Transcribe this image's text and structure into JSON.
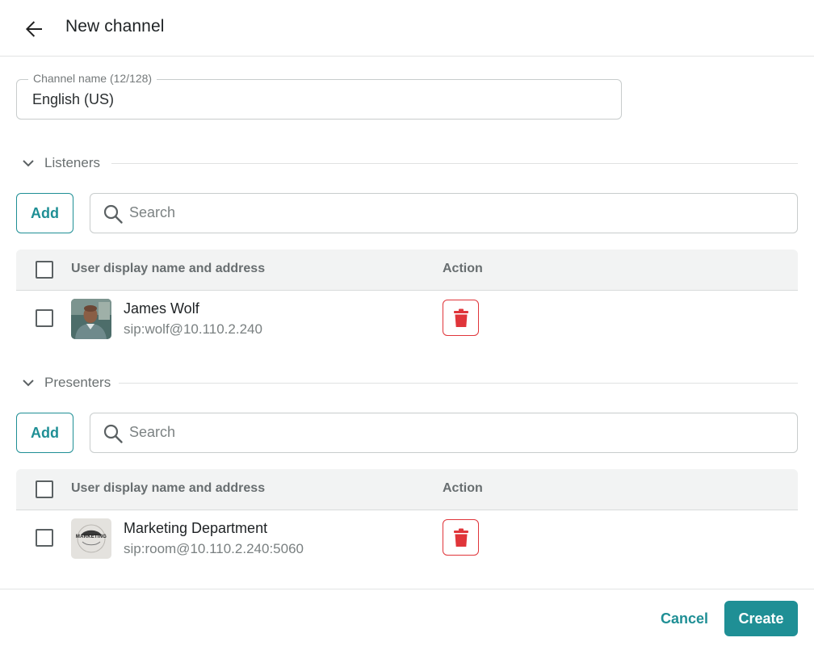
{
  "header": {
    "title": "New channel"
  },
  "channel_name": {
    "label": "Channel name (12/128)",
    "value": "English (US)"
  },
  "listeners": {
    "section_label": "Listeners",
    "add_label": "Add",
    "search_placeholder": "Search",
    "columns": {
      "user": "User display name and address",
      "action": "Action"
    },
    "rows": [
      {
        "name": "James Wolf",
        "address": "sip:wolf@10.110.2.240",
        "avatar": "person-photo"
      }
    ]
  },
  "presenters": {
    "section_label": "Presenters",
    "add_label": "Add",
    "search_placeholder": "Search",
    "columns": {
      "user": "User display name and address",
      "action": "Action"
    },
    "rows": [
      {
        "name": "Marketing Department",
        "address": "sip:room@10.110.2.240:5060",
        "avatar": "marketing-logo",
        "avatar_text": "MARKETING"
      }
    ]
  },
  "footer": {
    "cancel_label": "Cancel",
    "create_label": "Create"
  },
  "colors": {
    "accent": "#1f8f95",
    "danger": "#e0353a",
    "table_header_bg": "#f2f3f3"
  },
  "icons": {
    "back": "arrow-left-icon",
    "chevron": "chevron-down-icon",
    "search": "search-icon",
    "delete": "trash-icon"
  }
}
